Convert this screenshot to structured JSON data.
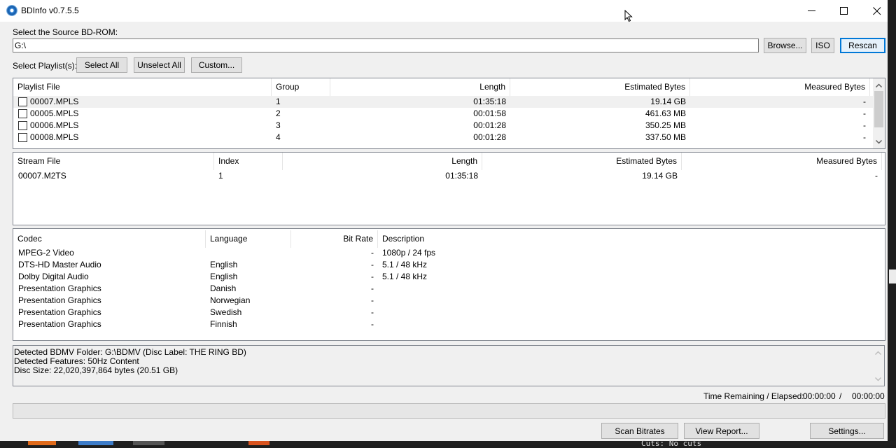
{
  "window": {
    "title": "BDInfo v0.7.5.5"
  },
  "source": {
    "label": "Select the Source BD-ROM:",
    "path": "G:\\",
    "browse_label": "Browse...",
    "iso_label": "ISO",
    "rescan_label": "Rescan"
  },
  "playlist_controls": {
    "label": "Select Playlist(s):",
    "select_all": "Select All",
    "unselect_all": "Unselect All",
    "custom": "Custom..."
  },
  "playlists": {
    "headers": [
      "Playlist File",
      "Group",
      "Length",
      "Estimated Bytes",
      "Measured Bytes"
    ],
    "rows": [
      {
        "file": "00007.MPLS",
        "group": "1",
        "length": "01:35:18",
        "est": "19.14 GB",
        "meas": "-"
      },
      {
        "file": "00005.MPLS",
        "group": "2",
        "length": "00:01:58",
        "est": "461.63 MB",
        "meas": "-"
      },
      {
        "file": "00006.MPLS",
        "group": "3",
        "length": "00:01:28",
        "est": "350.25 MB",
        "meas": "-"
      },
      {
        "file": "00008.MPLS",
        "group": "4",
        "length": "00:01:28",
        "est": "337.50 MB",
        "meas": "-"
      }
    ]
  },
  "streams": {
    "headers": [
      "Stream File",
      "Index",
      "Length",
      "Estimated Bytes",
      "Measured Bytes"
    ],
    "rows": [
      {
        "file": "00007.M2TS",
        "index": "1",
        "length": "01:35:18",
        "est": "19.14 GB",
        "meas": "-"
      }
    ]
  },
  "codecs": {
    "headers": [
      "Codec",
      "Language",
      "Bit Rate",
      "Description"
    ],
    "rows": [
      {
        "codec": "MPEG-2 Video",
        "language": "",
        "bitrate": "-",
        "description": "1080p / 24 fps"
      },
      {
        "codec": "DTS-HD Master Audio",
        "language": "English",
        "bitrate": "-",
        "description": "5.1 / 48 kHz"
      },
      {
        "codec": "Dolby Digital Audio",
        "language": "English",
        "bitrate": "-",
        "description": "5.1 / 48 kHz"
      },
      {
        "codec": "Presentation Graphics",
        "language": "Danish",
        "bitrate": "-",
        "description": ""
      },
      {
        "codec": "Presentation Graphics",
        "language": "Norwegian",
        "bitrate": "-",
        "description": ""
      },
      {
        "codec": "Presentation Graphics",
        "language": "Swedish",
        "bitrate": "-",
        "description": ""
      },
      {
        "codec": "Presentation Graphics",
        "language": "Finnish",
        "bitrate": "-",
        "description": ""
      }
    ]
  },
  "log": [
    "Detected BDMV Folder: G:\\BDMV (Disc Label: THE RING BD)",
    "Detected Features: 50Hz Content",
    "Disc Size: 22,020,397,864 bytes (20.51 GB)"
  ],
  "status": {
    "time_label": "Time Remaining / Elapsed:",
    "remaining": "00:00:00",
    "separator": "/",
    "elapsed": "00:00:00"
  },
  "actions": {
    "scan": "Scan Bitrates",
    "report": "View Report...",
    "settings": "Settings..."
  },
  "background": {
    "terminal_text": "Cuts: No cuts"
  },
  "colors": {
    "accent": "#0078d7",
    "window_bg": "#f0f0f0",
    "list_bg": "#ffffff"
  },
  "icons": [
    "bdinfo-disc-icon",
    "minimize-icon",
    "maximize-icon",
    "close-icon",
    "mouse-cursor-icon",
    "checkbox-icon",
    "scroll-up-icon",
    "scroll-down-icon"
  ]
}
